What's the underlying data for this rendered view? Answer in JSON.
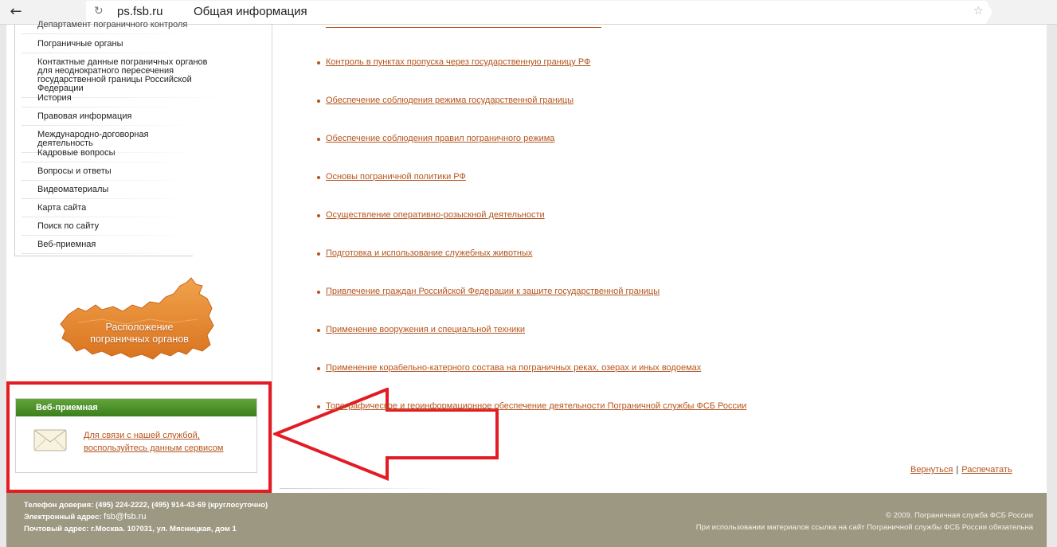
{
  "browser": {
    "url_domain": "ps.fsb.ru",
    "page_title": "Общая информация"
  },
  "sidebar": {
    "items": [
      {
        "label": "Департамент пограничного контроля"
      },
      {
        "label": "Пограничные органы"
      },
      {
        "label": "Контактные данные пограничных органов для неоднократного пересечения государственной границы Российской Федерации"
      },
      {
        "label": "История"
      },
      {
        "label": "Правовая информация"
      },
      {
        "label": "Международно-договорная деятельность"
      },
      {
        "label": "Кадровые вопросы"
      },
      {
        "label": "Вопросы и ответы"
      },
      {
        "label": "Видеоматериалы"
      },
      {
        "label": "Карта сайта"
      },
      {
        "label": "Поиск по сайту"
      },
      {
        "label": "Веб-приемная"
      }
    ],
    "map_banner_text": "Расположение пограничных органов",
    "web_reception": {
      "title": "Веб-приемная",
      "link_text": "Для связи с нашей службой, воспользуйтесь данным сервисом"
    }
  },
  "content": {
    "links": [
      {
        "label": "Контроль в пунктах пропуска через государственную границу РФ"
      },
      {
        "label": "Обеспечение соблюдения режима государственной границы"
      },
      {
        "label": "Обеспечение соблюдения правил пограничного режима"
      },
      {
        "label": "Основы пограничной политики РФ"
      },
      {
        "label": "Осуществление оперативно-розыскной деятельности"
      },
      {
        "label": "Подготовка и использование служебных животных"
      },
      {
        "label": "Привлечение граждан Российской Федерации к защите государственной границы"
      },
      {
        "label": "Применение вооружения и специальной техники"
      },
      {
        "label": "Применение корабельно-катерного состава на пограничных реках, озерах и иных водоемах"
      },
      {
        "label": "Топографическое и геоинформационное обеспечение деятельности Пограничной службы ФСБ России"
      }
    ],
    "back_label": "Вернуться",
    "separator": "|",
    "print_label": "Распечатать"
  },
  "footer": {
    "hotline_label": "Телефон доверия:",
    "hotline_value": "(495) 224-2222, (495) 914-43-69 (круглосуточно)",
    "email_label": "Электронный адрес:",
    "email_value": "fsb@fsb.ru",
    "address_label": "Почтовый адрес:",
    "address_value": "г.Москва. 107031, ул. Мясницкая, дом 1",
    "copyright": "© 2009. Пограничная служба ФСБ России",
    "notice": "При использовании материалов ссылка на сайт Пограничной службы ФСБ России обязательна"
  },
  "colors": {
    "link": "#b5541d",
    "header_green": "#4a8f28",
    "footer_bg": "#9d9882",
    "highlight_red": "#e41b23",
    "map_orange": "#e98a33"
  },
  "icons": [
    "back-arrow-icon",
    "reload-icon",
    "star-icon",
    "envelope-icon",
    "russia-map-icon",
    "red-arrow-icon"
  ]
}
